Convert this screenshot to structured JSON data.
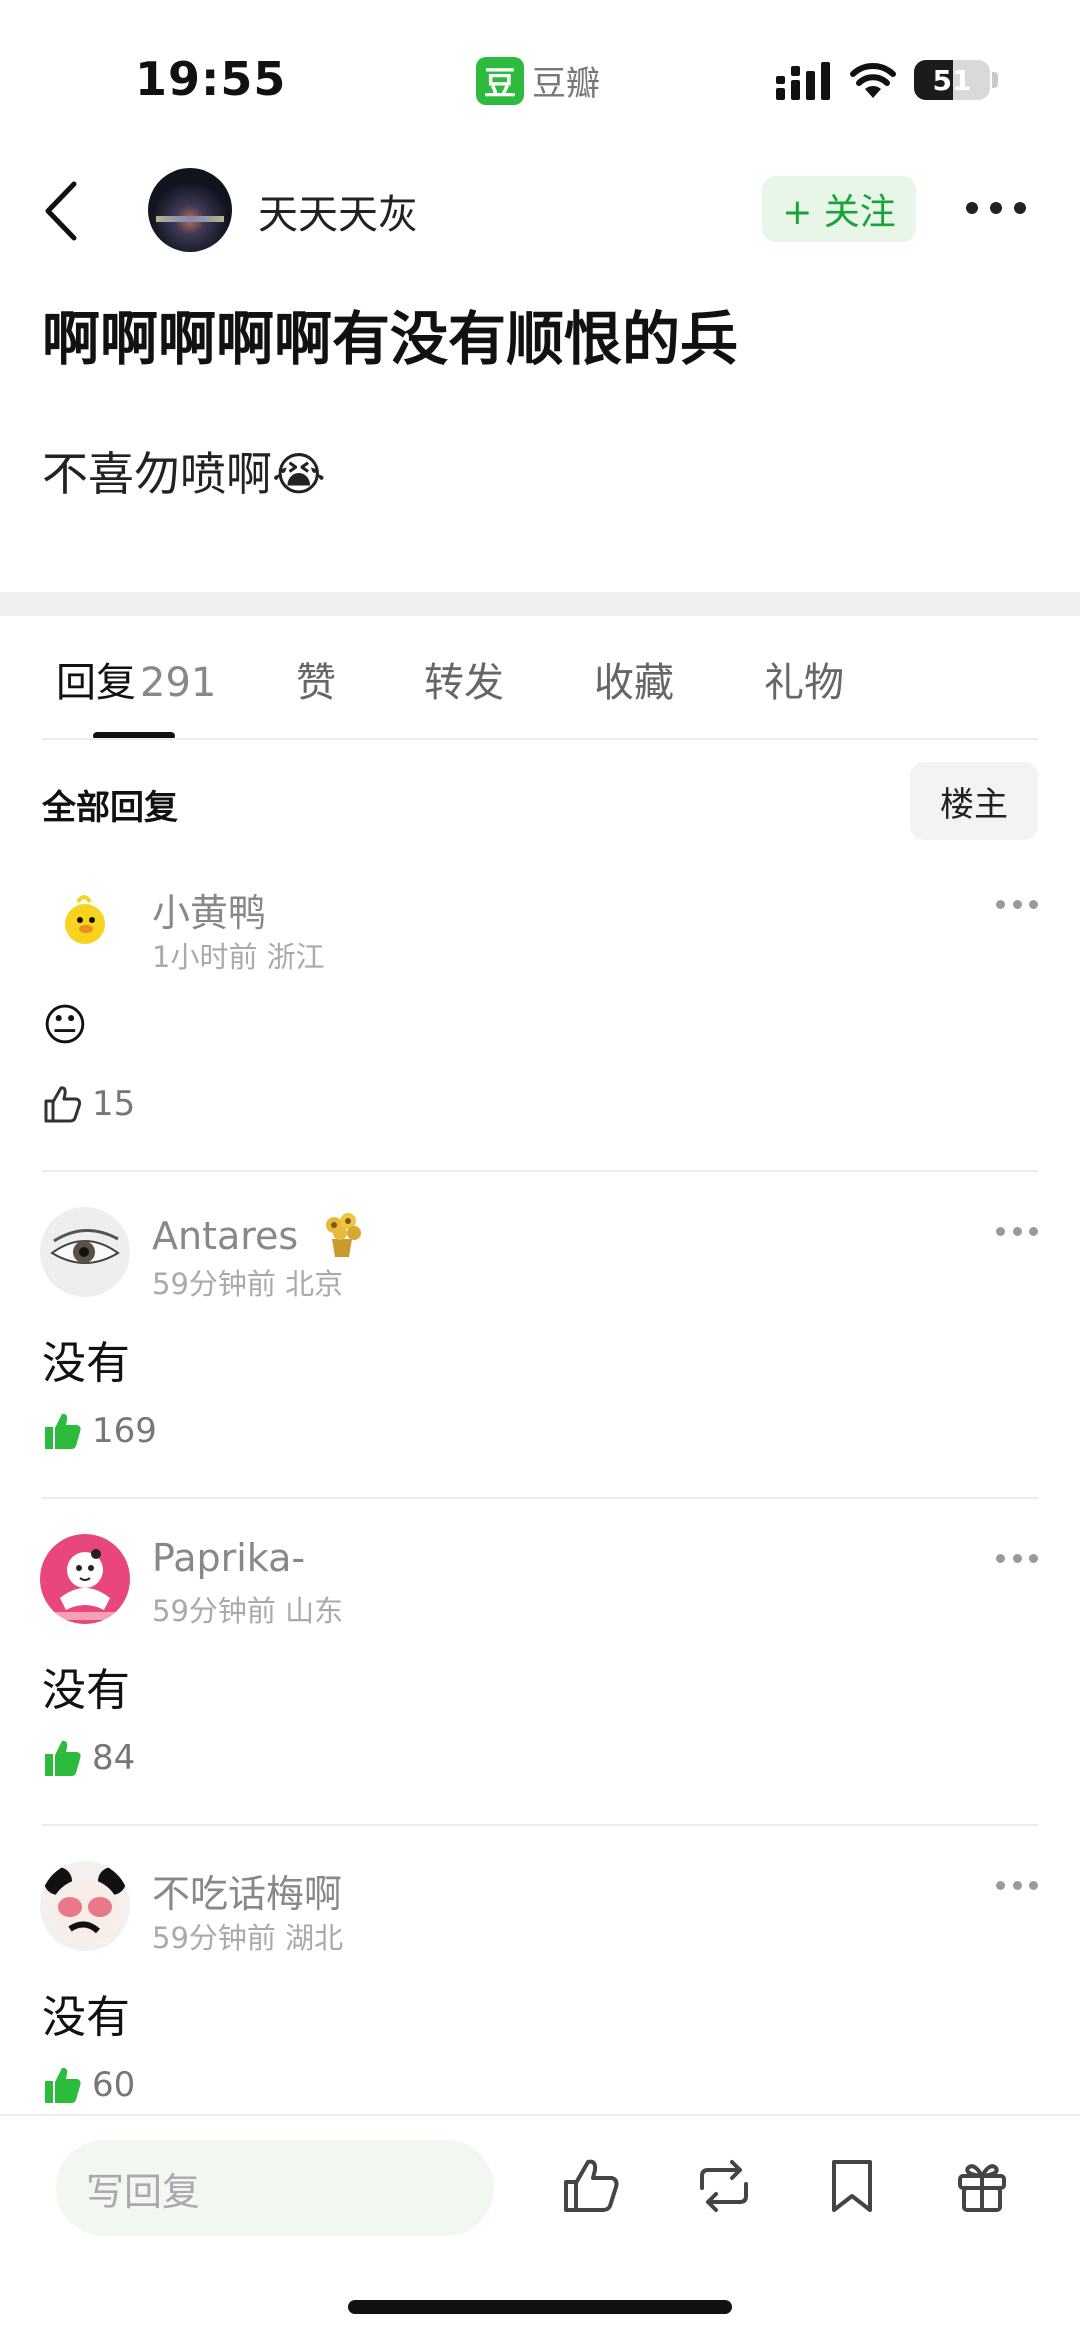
{
  "status": {
    "time": "19:55",
    "app_name": "豆瓣",
    "app_logo_char": "豆",
    "battery": "51",
    "battery_level": 0.51
  },
  "header": {
    "author": "天天天灰",
    "follow_label": "+ 关注"
  },
  "post": {
    "title": "啊啊啊啊啊有没有顺恨的兵",
    "body": "不喜勿喷啊😭"
  },
  "tabs": [
    {
      "label": "回复",
      "count": "291"
    },
    {
      "label": "赞"
    },
    {
      "label": "转发"
    },
    {
      "label": "收藏"
    },
    {
      "label": "礼物"
    }
  ],
  "replies": {
    "all_label": "全部回复",
    "owner_label": "楼主"
  },
  "comments": [
    {
      "name": "小黄鸭",
      "meta": "1小时前 浙江",
      "text": "😐",
      "likes": "15",
      "liked": false,
      "avatar": "duck-avatar"
    },
    {
      "name": "Antares",
      "meta": "59分钟前 北京",
      "text": "没有",
      "likes": "169",
      "liked": true,
      "avatar": "eye-avatar",
      "badge": "sunflower-badge"
    },
    {
      "name": "Paprika-",
      "meta": "59分钟前 山东",
      "text": "没有",
      "likes": "84",
      "liked": true,
      "avatar": "cartoon-avatar"
    },
    {
      "name": "不吃话梅啊",
      "meta": "59分钟前 湖北",
      "text": "没有",
      "likes": "60",
      "liked": true,
      "avatar": "panda-avatar"
    }
  ],
  "bottom": {
    "reply_placeholder": "写回复"
  },
  "colors": {
    "accent": "#1aa33a",
    "follow_bg": "#e7f6e7",
    "like_green": "#2dbb3d"
  }
}
